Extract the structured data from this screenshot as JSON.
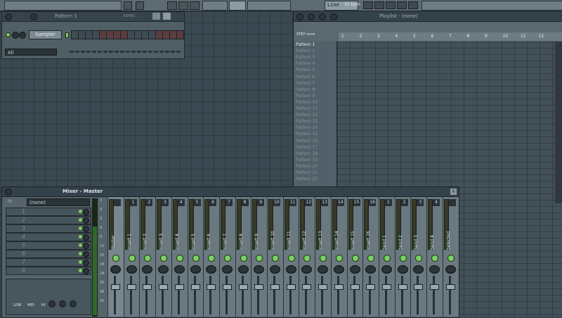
{
  "toolbar": {
    "lcd_text": "Line",
    "tempo": "35 bpm"
  },
  "channel_rack": {
    "title": "Pattern 1",
    "swing_label": "SWING",
    "channel_name": "Sampler",
    "filter_select": "All",
    "red_steps": [
      4,
      5,
      6,
      7,
      12,
      13,
      14,
      15
    ]
  },
  "playlist": {
    "title": "Playlist - (none)",
    "snap_label": "STEP",
    "snap_value": "none",
    "ruler": [
      "1",
      "2",
      "3",
      "4",
      "5",
      "6",
      "7",
      "8",
      "9",
      "10",
      "11",
      "12"
    ],
    "patterns": [
      "Pattern 1",
      "Pattern 2",
      "Pattern 3",
      "Pattern 4",
      "Pattern 5",
      "Pattern 6",
      "Pattern 7",
      "Pattern 8",
      "Pattern 9",
      "Pattern 10",
      "Pattern 11",
      "Pattern 12",
      "Pattern 13",
      "Pattern 14",
      "Pattern 15",
      "Pattern 16",
      "Pattern 17",
      "Pattern 18",
      "Pattern 19",
      "Pattern 20",
      "Pattern 21",
      "Pattern 22"
    ],
    "selected_pattern": "Pattern 1"
  },
  "mixer": {
    "title": "Mixer - Master",
    "input_label": "IN",
    "input_value": "(none)",
    "fx_slots": [
      "1",
      "2",
      "3",
      "4",
      "5",
      "6",
      "7",
      "8"
    ],
    "eq_labels": [
      "LOW",
      "MID",
      "HI"
    ],
    "db_ticks": [
      "3",
      "0",
      "3",
      "6",
      "9",
      "12",
      "15",
      "18",
      "24",
      "30",
      "36",
      "42"
    ],
    "tracks": [
      {
        "num": "",
        "name": "Master"
      },
      {
        "num": "1",
        "name": "Insert 1"
      },
      {
        "num": "2",
        "name": "Insert 2"
      },
      {
        "num": "3",
        "name": "Insert 3"
      },
      {
        "num": "4",
        "name": "Insert 4"
      },
      {
        "num": "5",
        "name": "Insert 5"
      },
      {
        "num": "6",
        "name": "Insert 6"
      },
      {
        "num": "7",
        "name": "Insert 7"
      },
      {
        "num": "8",
        "name": "Insert 8"
      },
      {
        "num": "9",
        "name": "Insert 9"
      },
      {
        "num": "10",
        "name": "Insert 10"
      },
      {
        "num": "11",
        "name": "Insert 11"
      },
      {
        "num": "12",
        "name": "Insert 12"
      },
      {
        "num": "13",
        "name": "Insert 13"
      },
      {
        "num": "14",
        "name": "Insert 14"
      },
      {
        "num": "15",
        "name": "Insert 15"
      },
      {
        "num": "16",
        "name": "Insert 16"
      },
      {
        "num": "1",
        "name": "Send 1"
      },
      {
        "num": "2",
        "name": "Send 2"
      },
      {
        "num": "3",
        "name": "Send 3"
      },
      {
        "num": "4",
        "name": "Send 4"
      },
      {
        "num": "",
        "name": "Selected"
      }
    ]
  }
}
